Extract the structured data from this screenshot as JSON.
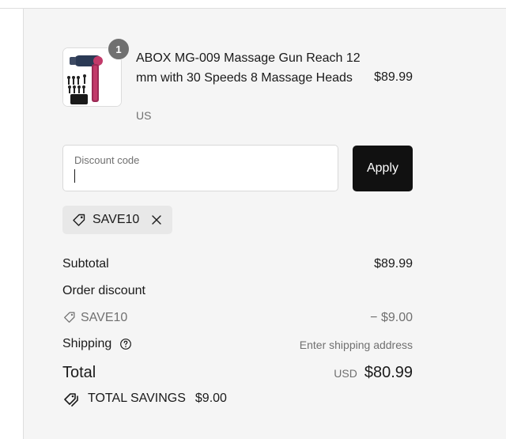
{
  "product": {
    "name": "ABOX MG-009 Massage Gun Reach 12 mm with 30 Speeds 8 Massage Heads",
    "variant": "US",
    "price": "$89.99",
    "quantity": "1",
    "thumb_icon": "massage-gun-image"
  },
  "discount": {
    "label": "Discount code",
    "value": "",
    "apply_label": "Apply",
    "applied_code": "SAVE10"
  },
  "summary": {
    "subtotal_label": "Subtotal",
    "subtotal_value": "$89.99",
    "order_discount_label": "Order discount",
    "discount_code": "SAVE10",
    "discount_value": "− $9.00",
    "shipping_label": "Shipping",
    "shipping_value": "Enter shipping address",
    "total_label": "Total",
    "currency": "USD",
    "total_value": "$80.99",
    "savings_label": "TOTAL SAVINGS",
    "savings_value": "$9.00"
  },
  "colors": {
    "panel_bg": "#f5f5f5",
    "button_bg": "#111111",
    "muted_text": "#707070"
  }
}
